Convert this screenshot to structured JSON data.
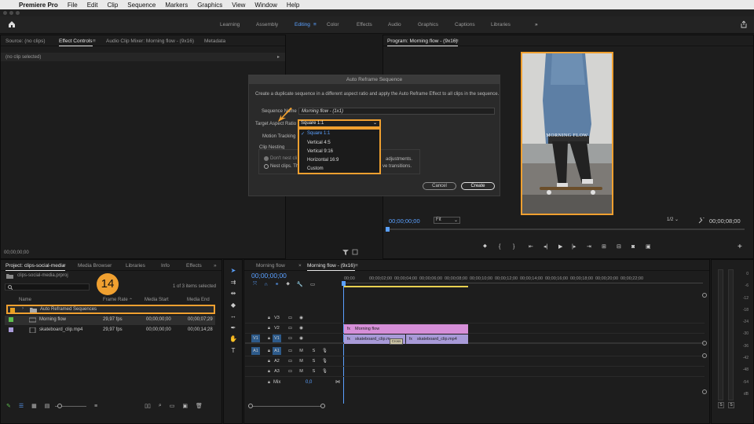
{
  "menubar": {
    "app": "Premiere Pro",
    "items": [
      "File",
      "Edit",
      "Clip",
      "Sequence",
      "Markers",
      "Graphics",
      "View",
      "Window",
      "Help"
    ]
  },
  "workspaces": {
    "items": [
      "Learning",
      "Assembly",
      "Editing",
      "Color",
      "Effects",
      "Audio",
      "Graphics",
      "Captions",
      "Libraries"
    ],
    "active": "Editing",
    "more": "»"
  },
  "source_panel": {
    "tabs": [
      "Source: (no clips)",
      "Effect Controls",
      "Audio Clip Mixer: Morning flow - (9x16)",
      "Metadata"
    ],
    "no_clip": "(no clip selected)",
    "timecode": "00;00;00;00"
  },
  "program": {
    "title": "Program: Morning flow - (9x16)",
    "overlay_text": "MORNING FLOW",
    "timecode": "00;00;00;00",
    "fit": "Fit",
    "resolution": "1/2",
    "duration": "00;00;08;00"
  },
  "dialog": {
    "title": "Auto Reframe Sequence",
    "description": "Create a duplicate sequence in a different aspect ratio and apply the Auto Reframe Effect to all clips in the sequence.",
    "sequence_name_label": "Sequence Name",
    "sequence_name_value": "Morning flow - (1x1)",
    "aspect_label": "Target Aspect Ratio",
    "aspect_value": "Square 1:1",
    "motion_label": "Motion Tracking",
    "nesting_label": "Clip Nesting",
    "option1": "Don't nest cli",
    "option1_tail": "adjustments.",
    "option2": "Nest clips. Th",
    "option2_tail": "ve transitions.",
    "options": [
      "Square 1:1",
      "Vertical 4:5",
      "Vertical 9:16",
      "Horizontal 16:9",
      "Custom"
    ],
    "selected_option": "Square 1:1",
    "cancel": "Cancel",
    "create": "Create"
  },
  "project": {
    "tabs": [
      "Project: clips-social-media",
      "Media Browser",
      "Libraries",
      "Info",
      "Effects"
    ],
    "file": "clips-social-media.prproj",
    "selection": "1 of 3 items selected",
    "step": "14",
    "columns": [
      "Name",
      "Frame Rate",
      "Media Start",
      "Media End"
    ],
    "rows": [
      {
        "name": "Auto Reframed Sequences",
        "rate": "",
        "start": "",
        "end": "",
        "color": "#e8a020"
      },
      {
        "name": "Morning flow",
        "rate": "29,97 fps",
        "start": "00;00;00;00",
        "end": "00;00;07;29",
        "color": "#5fbf4f"
      },
      {
        "name": "skateboard_clip.mp4",
        "rate": "29,97 fps",
        "start": "00;00;00;00",
        "end": "00;00;14;28",
        "color": "#a89ad8"
      }
    ]
  },
  "timeline": {
    "tabs": [
      "Morning flow",
      "Morning flow - (9x16)"
    ],
    "timecode": "00;00;00;00",
    "ruler": [
      "00;00",
      "00;00;02;00",
      "00;00;04;00",
      "00;00;06;00",
      "00;00;08;00",
      "00;00;10;00",
      "00;00;12;00",
      "00;00;14;00",
      "00;00;16;00",
      "00;00;18;00",
      "00;00;20;00",
      "00;00;22;00"
    ],
    "video_tracks": [
      "V3",
      "V2",
      "V1"
    ],
    "audio_tracks": [
      "A1",
      "A2",
      "A3"
    ],
    "src_v": "V1",
    "src_a": "A1",
    "mix_label": "Mix",
    "mix_value": "0,0",
    "clip_v2": "Morning flow",
    "clip_v1a": "skateboard_clip.m",
    "clip_v1b": "skateboard_clip.mp4",
    "cross": "Cross"
  },
  "meter": {
    "labels": [
      "0",
      "-6",
      "-12",
      "-18",
      "-24",
      "-30",
      "-36",
      "-42",
      "-48",
      "-54",
      "dB"
    ],
    "solo": [
      "S",
      "S"
    ]
  }
}
